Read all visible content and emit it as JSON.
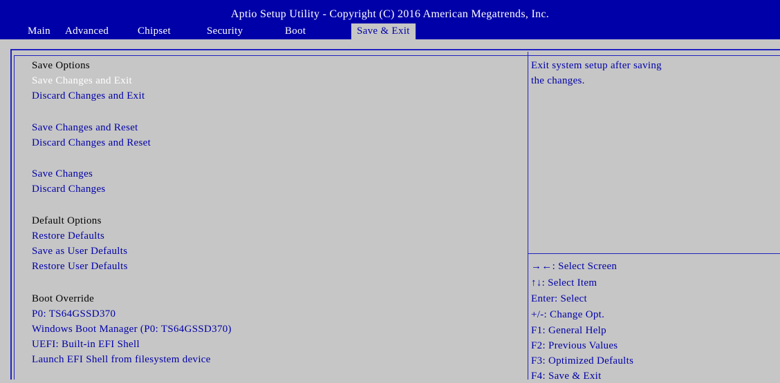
{
  "title": "Aptio Setup Utility - Copyright (C) 2016 American Megatrends, Inc.",
  "tabs": [
    {
      "label": "Main"
    },
    {
      "label": "Advanced"
    },
    {
      "label": "Chipset"
    },
    {
      "label": "Security"
    },
    {
      "label": "Boot"
    },
    {
      "label": "Save & Exit",
      "active": true
    }
  ],
  "menu": {
    "save_options_header": "Save Options",
    "save_changes_and_exit": "Save Changes and Exit",
    "discard_changes_and_exit": "Discard Changes and Exit",
    "save_changes_and_reset": "Save Changes and Reset",
    "discard_changes_and_reset": "Discard Changes and Reset",
    "save_changes": "Save Changes",
    "discard_changes": "Discard Changes",
    "default_options_header": "Default Options",
    "restore_defaults": "Restore Defaults",
    "save_as_user_defaults": "Save as User Defaults",
    "restore_user_defaults": "Restore User Defaults",
    "boot_override_header": "Boot Override",
    "boot_p0": "P0: TS64GSSD370",
    "boot_windows": "Windows Boot Manager (P0: TS64GSSD370)",
    "boot_uefi_shell": "UEFI: Built-in EFI Shell",
    "launch_efi_shell": "Launch EFI Shell from filesystem device"
  },
  "help": {
    "line1": "Exit system setup after saving",
    "line2": "the changes."
  },
  "keys": [
    "→←: Select Screen",
    "↑↓: Select Item",
    "Enter: Select",
    "+/-: Change Opt.",
    "F1: General Help",
    "F2: Previous Values",
    "F3: Optimized Defaults",
    "F4: Save & Exit"
  ],
  "colors": {
    "title_bg": "#0000a8",
    "panel_bg": "#c6c6c6",
    "option_text": "#0000a8",
    "selected_text": "#ffffff",
    "header_text": "#000000"
  }
}
